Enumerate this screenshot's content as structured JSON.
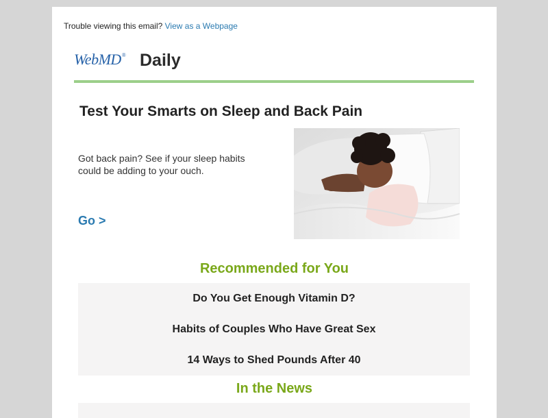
{
  "header": {
    "trouble_text": "Trouble viewing this email?",
    "view_link": "View as a Webpage",
    "logo_text": "WebMD",
    "logo_mark": "®",
    "daily_label": "Daily"
  },
  "feature": {
    "title": "Test Your Smarts on Sleep and Back Pain",
    "teaser": "Got back pain? See if your sleep habits could be adding to your ouch.",
    "cta": "Go >"
  },
  "recommended": {
    "heading": "Recommended for You",
    "items": [
      "Do You Get Enough Vitamin D?",
      "Habits of Couples Who Have Great Sex",
      "14 Ways to Shed Pounds After 40"
    ]
  },
  "news": {
    "heading": "In the News"
  },
  "colors": {
    "background": "#d6d6d6",
    "link_blue": "#2a7ab0",
    "logo_blue": "#2561a8",
    "accent_green": "#7aa81a",
    "rule_green": "#9ccf8a",
    "panel_gray": "#f5f4f4"
  }
}
